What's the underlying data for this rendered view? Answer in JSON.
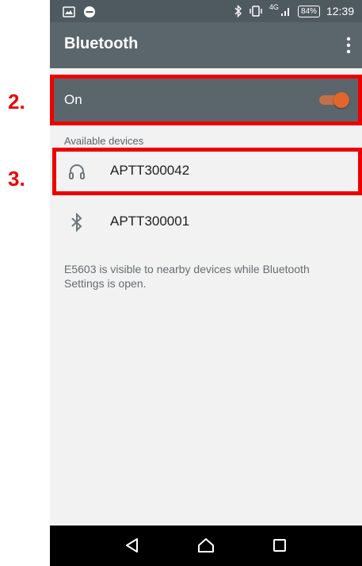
{
  "status_bar": {
    "network_label": "4G",
    "battery": "84%",
    "time": "12:39"
  },
  "app_bar": {
    "title": "Bluetooth"
  },
  "bluetooth_switch": {
    "label": "On"
  },
  "available_devices": {
    "header": "Available devices",
    "items": [
      {
        "name": "APTT300042",
        "icon": "headset-icon"
      },
      {
        "name": "APTT300001",
        "icon": "bluetooth-icon"
      }
    ]
  },
  "visibility_notice": "E5603 is visible to nearby devices while Bluetooth Settings is open.",
  "annotations": {
    "step_2": "2.",
    "step_3": "3."
  },
  "colors": {
    "annotation_red": "#ee0000",
    "toggle_accent": "#e0662c",
    "app_bar": "#5a666c"
  }
}
